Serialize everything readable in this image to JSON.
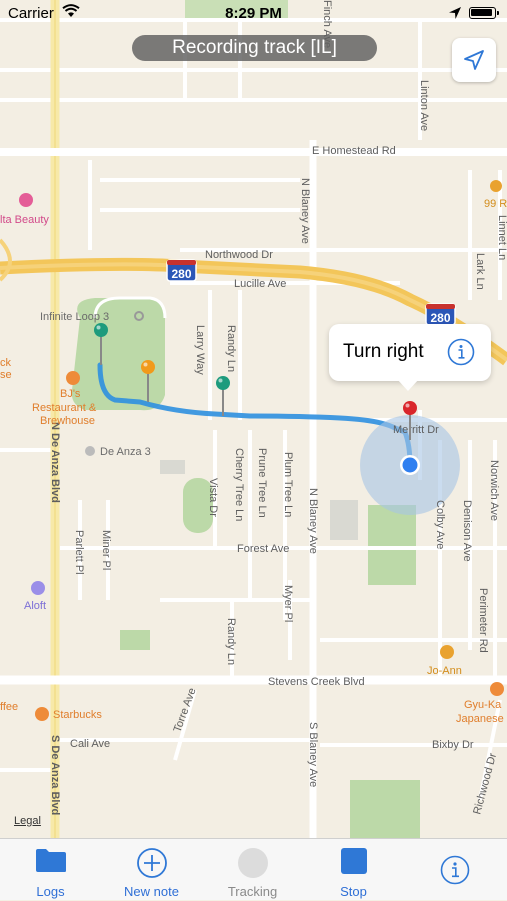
{
  "status_bar": {
    "carrier": "Carrier",
    "time": "8:29 PM"
  },
  "recording_banner": "Recording track [IL]",
  "callout": {
    "text": "Turn right"
  },
  "map": {
    "roads": {
      "homestead": "E Homestead Rd",
      "northwood": "Northwood Dr",
      "lucille": "Lucille Ave",
      "forest": "Forest Ave",
      "stevens_creek": "Stevens Creek Blvd",
      "cali": "Cali Ave",
      "bixby": "Bixby Dr",
      "de_anza_n": "N De Anza Blvd",
      "de_anza_s": "S De Anza Blvd",
      "blaney_n": "N Blaney Ave",
      "blaney_s": "S Blaney Ave",
      "larry": "Larry Way",
      "randy": "Randy Ln",
      "randy2": "Randy Ln",
      "cherry": "Cherry Tree Ln",
      "prune": "Prune Tree Ln",
      "plum": "Plum Tree Ln",
      "vista": "Vista Dr",
      "miner": "Miner Pl",
      "parlett": "Parlett Pl",
      "myer": "Myer Pl",
      "colby": "Colby Ave",
      "denison": "Denison Ave",
      "norwich": "Norwich Ave",
      "perimeter": "Perimeter Rd",
      "torre": "Torre Ave",
      "richwood": "Richwood Dr",
      "lark": "Lark Ln",
      "linnet": "Linnet Ln",
      "finch": "Finch Ave",
      "linton": "Linton Ave",
      "merritt": "Merritt Dr",
      "hwy": "280",
      "hwy2": "280"
    },
    "pois": {
      "infinite_loop": "Infinite Loop 3",
      "de_anza": "De Anza 3",
      "bjs_1": "BJ's",
      "bjs_2": "Restaurant &",
      "bjs_3": "Brewhouse",
      "ulta": "lta Beauty",
      "aloft": "Aloft",
      "starbucks": "Starbucks",
      "joann": "Jo-Ann",
      "gyu_1": "Gyu-Ka",
      "gyu_2": "Japanese",
      "ck": "ck",
      "se": "se",
      "ffee": "ffee",
      "ninety9": "99 R"
    }
  },
  "legal": "Legal",
  "tabs": [
    {
      "label": "Logs"
    },
    {
      "label": "New note"
    },
    {
      "label": "Tracking"
    },
    {
      "label": "Stop"
    },
    {
      "label": ""
    }
  ]
}
